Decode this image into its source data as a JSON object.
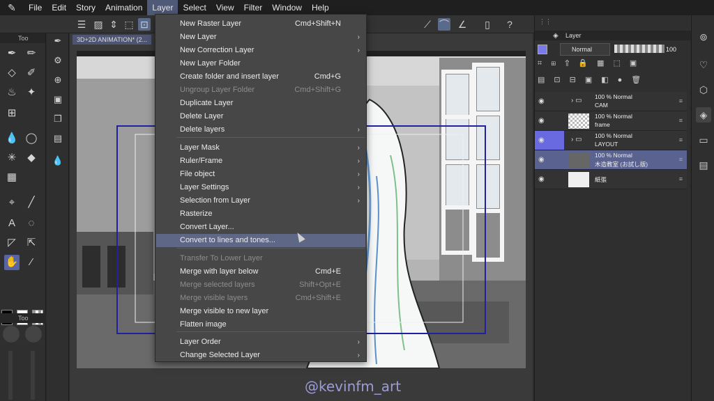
{
  "menubar": {
    "items": [
      "File",
      "Edit",
      "Story",
      "Animation",
      "Layer",
      "Select",
      "View",
      "Filter",
      "Window",
      "Help"
    ]
  },
  "document": {
    "tab_title": "3D+2D ANIMATION* (2..."
  },
  "left_panel": {
    "tab_label": "Too",
    "sub_tab_label": "Too"
  },
  "layer_menu": {
    "items": [
      {
        "label": "New Raster Layer",
        "shortcut": "Cmd+Shift+N"
      },
      {
        "label": "New Layer",
        "submenu": true
      },
      {
        "label": "New Correction Layer",
        "submenu": true
      },
      {
        "label": "New Layer Folder"
      },
      {
        "label": "Create folder and insert layer",
        "shortcut": "Cmd+G"
      },
      {
        "label": "Ungroup Layer Folder",
        "shortcut": "Cmd+Shift+G",
        "disabled": true
      },
      {
        "label": "Duplicate Layer"
      },
      {
        "label": "Delete Layer"
      },
      {
        "label": "Delete layers",
        "submenu": true
      },
      {
        "label": "Layer Mask",
        "submenu": true
      },
      {
        "label": "Ruler/Frame",
        "submenu": true
      },
      {
        "label": "File object",
        "submenu": true
      },
      {
        "label": "Layer Settings",
        "submenu": true
      },
      {
        "label": "Selection from Layer",
        "submenu": true
      },
      {
        "label": "Rasterize"
      },
      {
        "label": "Convert Layer..."
      },
      {
        "label": "Convert to lines and tones...",
        "highlighted": true
      },
      {
        "label": "Transfer To Lower Layer",
        "disabled": true
      },
      {
        "label": "Merge with layer below",
        "shortcut": "Cmd+E"
      },
      {
        "label": "Merge selected layers",
        "shortcut": "Shift+Opt+E",
        "disabled": true
      },
      {
        "label": "Merge visible layers",
        "shortcut": "Cmd+Shift+E",
        "disabled": true
      },
      {
        "label": "Merge visible to new layer"
      },
      {
        "label": "Flatten image"
      },
      {
        "label": "Layer Order",
        "submenu": true
      },
      {
        "label": "Change Selected Layer",
        "submenu": true
      }
    ],
    "arrow_glyph": "›"
  },
  "layer_panel": {
    "title": "Layer",
    "blend_mode": "Normal",
    "opacity": "100",
    "layers": [
      {
        "line1": "100 %  Normal",
        "line2": "CAM",
        "kind": "folder",
        "selected": false
      },
      {
        "line1": "100 %  Normal",
        "line2": "frame",
        "kind": "raster",
        "selected": false
      },
      {
        "line1": "100 %  Normal",
        "line2": "LAYOUT",
        "kind": "folder",
        "selected": false,
        "highlighted_icons": true
      },
      {
        "line1": "100 %  Normal",
        "line2": "木造教室 (お試し版)",
        "kind": "3d",
        "selected": true
      },
      {
        "line1": "",
        "line2": "紙張",
        "kind": "paper",
        "selected": false
      }
    ]
  },
  "watermark": "@kevinfm_art",
  "colors": {
    "accent": "#5a6290",
    "menu_highlight": "#5e6886",
    "selected_tool": "#5865a4"
  }
}
